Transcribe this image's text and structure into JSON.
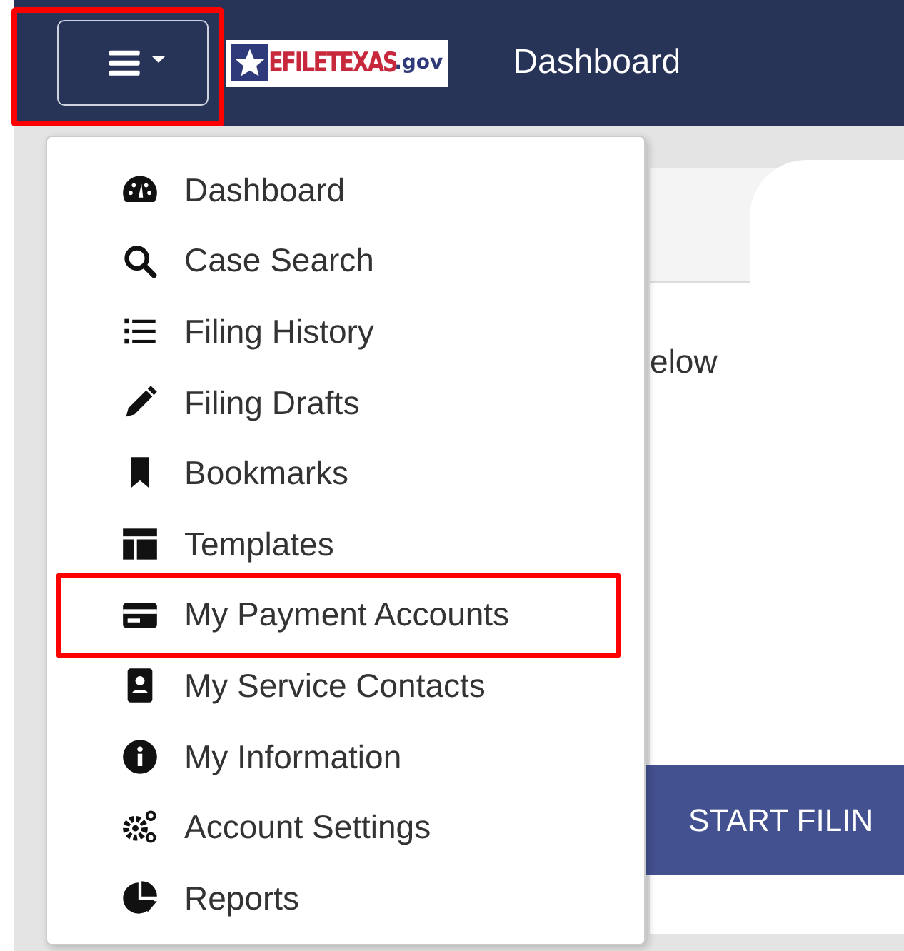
{
  "navbar": {
    "menu_button": {
      "highlighted": true
    },
    "logo": {
      "text": "EFILETEXAS",
      "suffix": ".gov"
    },
    "title": "Dashboard"
  },
  "menu": [
    {
      "label": "Dashboard",
      "highlighted": false
    },
    {
      "label": "Case Search",
      "highlighted": false
    },
    {
      "label": "Filing History",
      "highlighted": false
    },
    {
      "label": "Filing Drafts",
      "highlighted": false
    },
    {
      "label": "Bookmarks",
      "highlighted": false
    },
    {
      "label": "Templates",
      "highlighted": false
    },
    {
      "label": "My Payment Accounts",
      "highlighted": true
    },
    {
      "label": "My Service Contacts",
      "highlighted": false
    },
    {
      "label": "My Information",
      "highlighted": false
    },
    {
      "label": "Account Settings",
      "highlighted": false
    },
    {
      "label": "Reports",
      "highlighted": false
    }
  ],
  "content": {
    "text": "elow",
    "button": "START FILIN"
  }
}
